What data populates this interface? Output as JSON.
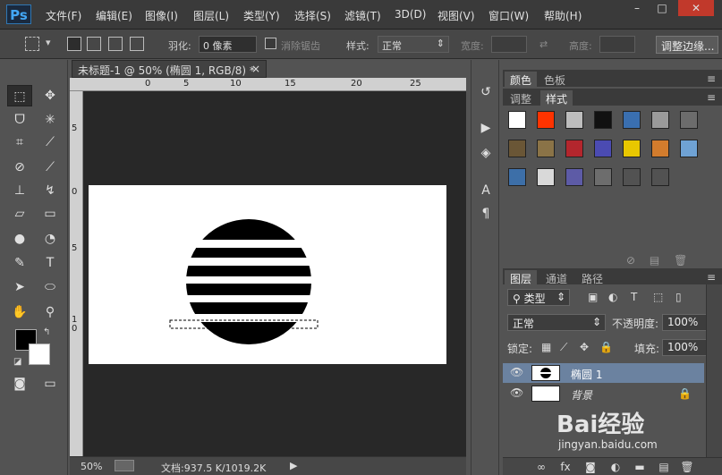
{
  "app": {
    "logo": "Ps"
  },
  "menu": [
    "文件(F)",
    "编辑(E)",
    "图像(I)",
    "图层(L)",
    "类型(Y)",
    "选择(S)",
    "滤镜(T)",
    "3D(D)",
    "视图(V)",
    "窗口(W)",
    "帮助(H)"
  ],
  "window_controls": {
    "minimize": "–",
    "maximize": "□",
    "close": "✕"
  },
  "options_bar": {
    "feather_label": "羽化:",
    "feather_value": "0 像素",
    "antialias_label": "消除锯齿",
    "style_label": "样式:",
    "style_value": "正常",
    "width_label": "宽度:",
    "height_label": "高度:",
    "refine_edge_button": "调整边缘..."
  },
  "document": {
    "tab_title": "未标题-1 @ 50% (椭圆 1, RGB/8) *",
    "tab_close": "×",
    "ruler_top": [
      "0",
      "5",
      "10",
      "15",
      "20",
      "25"
    ],
    "ruler_left": [
      "5",
      "0",
      "5",
      "1",
      "0"
    ]
  },
  "status": {
    "zoom": "50%",
    "doc_info": "文档:937.5 K/1019.2K"
  },
  "color_panel": {
    "tabs": [
      "颜色",
      "色板"
    ]
  },
  "styles_panel": {
    "tabs": [
      "调整",
      "样式"
    ],
    "swatches": [
      "#ffffff",
      "#ff3300",
      "#bdbdbd",
      "#111111",
      "#3a6fb0",
      "#9a9a9a",
      "#6c6c6c",
      "#6a5636",
      "#8a7347",
      "#b3262d",
      "#4b4bb2",
      "#e8c700",
      "#d27c2d",
      "#6fa2d4",
      "#3d6fa8",
      "#d9d9d9",
      "#5d5ba6",
      "#6d6d6d",
      "#525252",
      "#525252"
    ]
  },
  "layers_panel": {
    "tabs": [
      "图层",
      "通道",
      "路径"
    ],
    "kind_filter": "类型",
    "blend_mode": "正常",
    "opacity_label": "不透明度:",
    "opacity_value": "100%",
    "lock_label": "锁定:",
    "fill_label": "填充:",
    "fill_value": "100%",
    "layers": [
      {
        "name": "椭圆 1",
        "selected": true
      },
      {
        "name": "背景",
        "locked": true
      }
    ],
    "bottom_icons": [
      "link-icon",
      "fx-icon",
      "mask-icon",
      "adjustment-icon",
      "folder-icon",
      "new-layer-icon",
      "trash-icon"
    ]
  },
  "watermark": {
    "text": "Bai经验",
    "url": "jingyan.baidu.com"
  },
  "colors": {
    "accent": "#43a7f5",
    "selected_layer": "#6b82a0",
    "panel": "#535353"
  }
}
